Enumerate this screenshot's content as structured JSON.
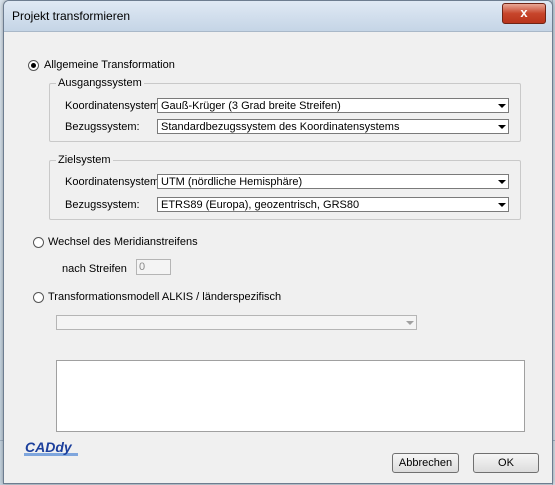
{
  "window": {
    "title": "Projekt transformieren",
    "close_symbol": "x"
  },
  "general": {
    "label": "Allgemeine Transformation",
    "selected": true,
    "source": {
      "title": "Ausgangssystem",
      "coord_label": "Koordinatensystem:",
      "coord_value": "Gauß-Krüger (3 Grad breite Streifen)",
      "ref_label": "Bezugssystem:",
      "ref_value": "Standardbezugssystem des Koordinatensystems"
    },
    "target": {
      "title": "Zielsystem",
      "coord_label": "Koordinatensystem:",
      "coord_value": "UTM (nördliche Hemisphäre)",
      "ref_label": "Bezugssystem:",
      "ref_value": "ETRS89 (Europa), geozentrisch, GRS80"
    }
  },
  "meridian": {
    "label": "Wechsel des Meridianstreifens",
    "selected": false,
    "strip_label": "nach Streifen",
    "strip_value": "0"
  },
  "alkis": {
    "label": "Transformationsmodell ALKIS / länderspezifisch",
    "selected": false,
    "combo_value": ""
  },
  "memo_text": "",
  "logo_text": "CADdy",
  "buttons": {
    "cancel": "Abbrechen",
    "ok": "OK"
  },
  "colors": {
    "logo_blue": "#1c3f9c",
    "logo_light": "#7fa6dd"
  }
}
